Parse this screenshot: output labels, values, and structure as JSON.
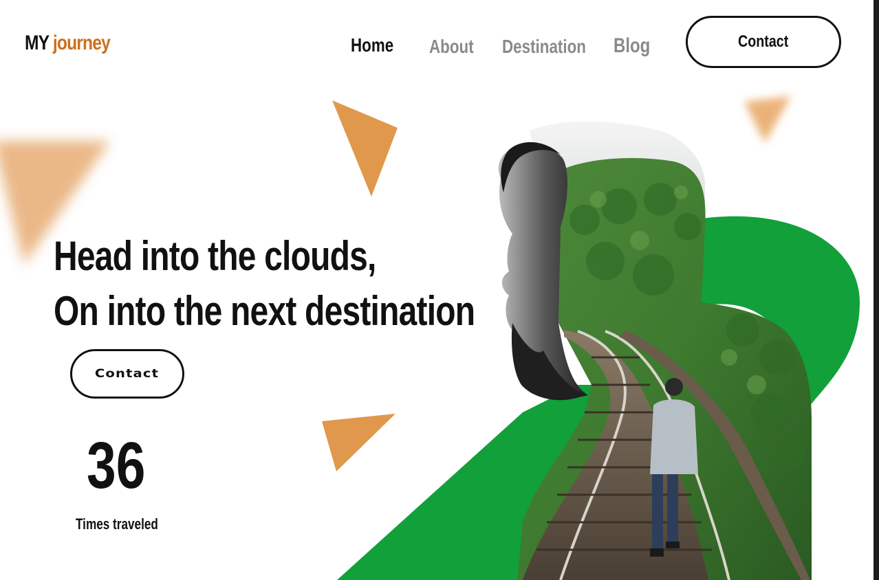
{
  "logo": {
    "my": "MY",
    "journey": "journey"
  },
  "nav": {
    "home": "Home",
    "about": "About",
    "destination": "Destination",
    "blog": "Blog",
    "contact_button": "Contact"
  },
  "hero": {
    "line1": "Head into the clouds,",
    "line2": "On into the next destination",
    "contact_button": "Contact"
  },
  "stats": {
    "value": "36",
    "label": "Times traveled"
  },
  "colors": {
    "brand_orange": "#cc6f1c",
    "accent_green": "#12a03a",
    "triangle_orange": "#e0984c",
    "text": "#111111",
    "nav_muted": "#8a8a8a"
  }
}
